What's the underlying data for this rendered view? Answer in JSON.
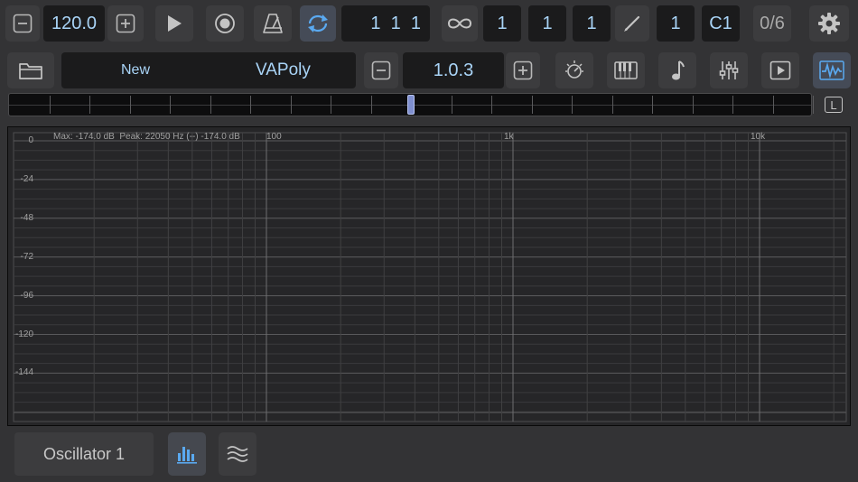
{
  "transport": {
    "tempo": "120.0",
    "position": "1  1  1",
    "loop_bars": "1",
    "loop_beats": "1",
    "loop_ticks": "1",
    "pencil_value": "1",
    "note": "C1",
    "voice_count": "0/6"
  },
  "preset": {
    "bank": "New",
    "name": "VAPoly",
    "version": "1.0.3"
  },
  "scrubber": {
    "lock_label": "L"
  },
  "analyzer": {
    "readout": "Max: -174.0 dB  Peak: 22050 Hz (--) -174.0 dB",
    "db_labels": [
      "0",
      "-24",
      "-48",
      "-72",
      "-96",
      "-120",
      "-144"
    ],
    "freq_labels": [
      "100",
      "1k",
      "10k"
    ]
  },
  "footer": {
    "module": "Oscillator 1"
  },
  "colors": {
    "accent": "#5aa9f0",
    "background": "#333335",
    "panel": "#262628"
  },
  "icons": [
    "minus-icon",
    "plus-icon",
    "play-icon",
    "record-icon",
    "metronome-icon",
    "loop-icon",
    "infinity-icon",
    "pencil-icon",
    "gear-icon",
    "folder-icon",
    "tuner-icon",
    "piano-icon",
    "note-icon",
    "sliders-icon",
    "play-box-icon",
    "waveform-icon",
    "spectrum-bars-icon",
    "waves-icon"
  ]
}
